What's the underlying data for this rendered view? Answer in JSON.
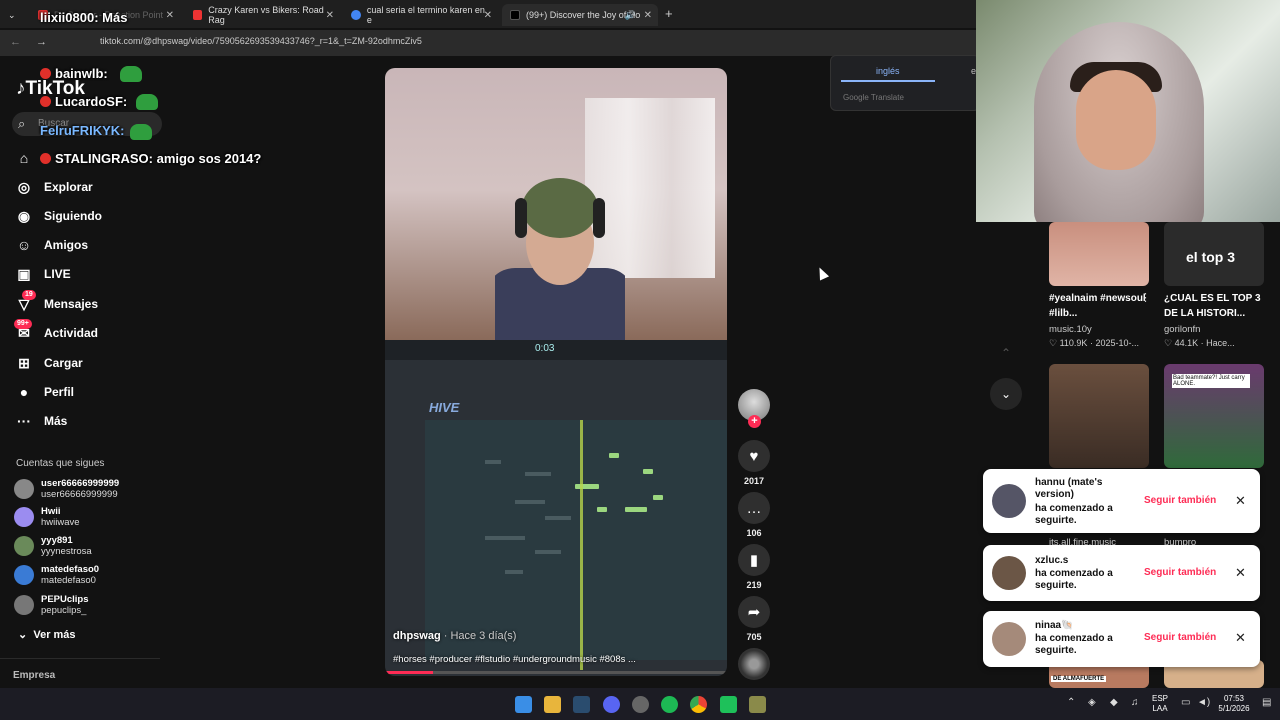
{
  "browser": {
    "tabs": [
      {
        "label": "Dr. Bazaar - Reaction Point",
        "overlay": "liixii0800: Más",
        "active": false
      },
      {
        "label": "Crazy Karen vs Bikers: Road Rag",
        "active": false
      },
      {
        "label": "cual seria el termino karen en e",
        "active": false
      },
      {
        "label": "(99+) Discover the Joy of Ho",
        "active": true
      }
    ],
    "new_tab": "+",
    "url": "tiktok.com/@dhpswag/video/7590562693539433746?_r=1&_t=ZM-92odhmcZiv5"
  },
  "sidebar": {
    "logo": "TikTok",
    "search_placeholder": "Buscar",
    "nav": [
      {
        "label": "",
        "icon": "home-icon"
      },
      {
        "label": "Explorar",
        "icon": "explore-icon"
      },
      {
        "label": "Siguiendo",
        "icon": "following-icon"
      },
      {
        "label": "Amigos",
        "icon": "friends-icon"
      },
      {
        "label": "LIVE",
        "icon": "live-icon"
      },
      {
        "label": "Mensajes",
        "icon": "messages-icon",
        "badge": "19"
      },
      {
        "label": "Actividad",
        "icon": "activity-icon",
        "badge": "99+"
      },
      {
        "label": "Cargar",
        "icon": "upload-icon"
      },
      {
        "label": "Perfil",
        "icon": "profile-icon"
      },
      {
        "label": "Más",
        "icon": "more-icon"
      }
    ],
    "following_title": "Cuentas que sigues",
    "following": [
      {
        "name": "user66666999999",
        "user": "user66666999999"
      },
      {
        "name": "Hwii",
        "user": "hwiiwave"
      },
      {
        "name": "yyy891",
        "user": "yyynestrosa"
      },
      {
        "name": "matedefaso0",
        "user": "matedefaso0"
      },
      {
        "name": "PEPUclips",
        "user": "pepuclips_"
      }
    ],
    "see_more": "Ver más",
    "company": "Empresa"
  },
  "chat": [
    {
      "text": "bainwlb:"
    },
    {
      "text": "LucardoSF:"
    },
    {
      "text": "FelruFRIKYK:"
    },
    {
      "text": "STALINGRASO: amigo sos 2014?"
    }
  ],
  "video": {
    "author": "dhpswag",
    "ago": " · Hace 3 día(s)",
    "description": "#horses #producer #flstudio #undergroundmusic #808s ...",
    "daw_time": "0:03",
    "daw_plugin": "HIVE",
    "progress": 0.14,
    "likes": "2017",
    "comments": "106",
    "saves": "219",
    "shares": "705"
  },
  "translate": {
    "lang": "inglés",
    "lang2": "es",
    "brand": "Google Translate"
  },
  "recommended": [
    {
      "title": "#yealnaim #newsoul #lilb...",
      "author": "music.10y",
      "likes": "110.9K",
      "date": "2025-10-..."
    },
    {
      "title": "¿CUAL ES EL TOP 3 DE LA HISTORI...",
      "author": "gorilonfn",
      "likes": "44.1K",
      "date": "Hace...",
      "overlay": "el top 3"
    },
    {
      "author": "its.all.fine.music",
      "overlay": "Bad teammate?! Just carry ALONE."
    },
    {
      "author": "bumpro"
    },
    {
      "overlay": "DE ALMAFUERTE"
    }
  ],
  "toasts": [
    {
      "name": "hannu (mate's version)",
      "msg": "ha comenzado a seguirte.",
      "btn": "Seguir también"
    },
    {
      "name": "xzluc.s",
      "msg": "ha comenzado a seguirte.",
      "btn": "Seguir también"
    },
    {
      "name": "ninaa🐚",
      "msg": "ha comenzado a seguirte.",
      "btn": "Seguir también"
    }
  ],
  "taskbar": {
    "lang": "ESP",
    "lang2": "LAA",
    "time": "07:53",
    "date": "5/1/2026"
  },
  "colors": {
    "accent": "#fe2c55",
    "bg": "#121212",
    "translate_accent": "#8ab4f8"
  }
}
